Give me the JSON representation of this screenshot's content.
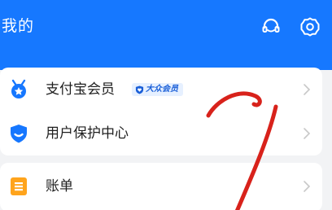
{
  "header": {
    "title": "我的",
    "background": "#1678ff",
    "icons": [
      "customer-service-icon",
      "settings-icon"
    ]
  },
  "membership_card": {
    "items": [
      {
        "label": "支付宝会员",
        "icon": "membership-medal-icon",
        "badge": "大众会员",
        "badge_icon": "shield-heart-icon"
      },
      {
        "label": "用户保护中心",
        "icon": "user-protection-shield-icon"
      }
    ]
  },
  "bill_card": {
    "items": [
      {
        "label": "账单",
        "icon": "bill-list-icon"
      }
    ]
  },
  "annotation": {
    "color": "#d8221b"
  }
}
